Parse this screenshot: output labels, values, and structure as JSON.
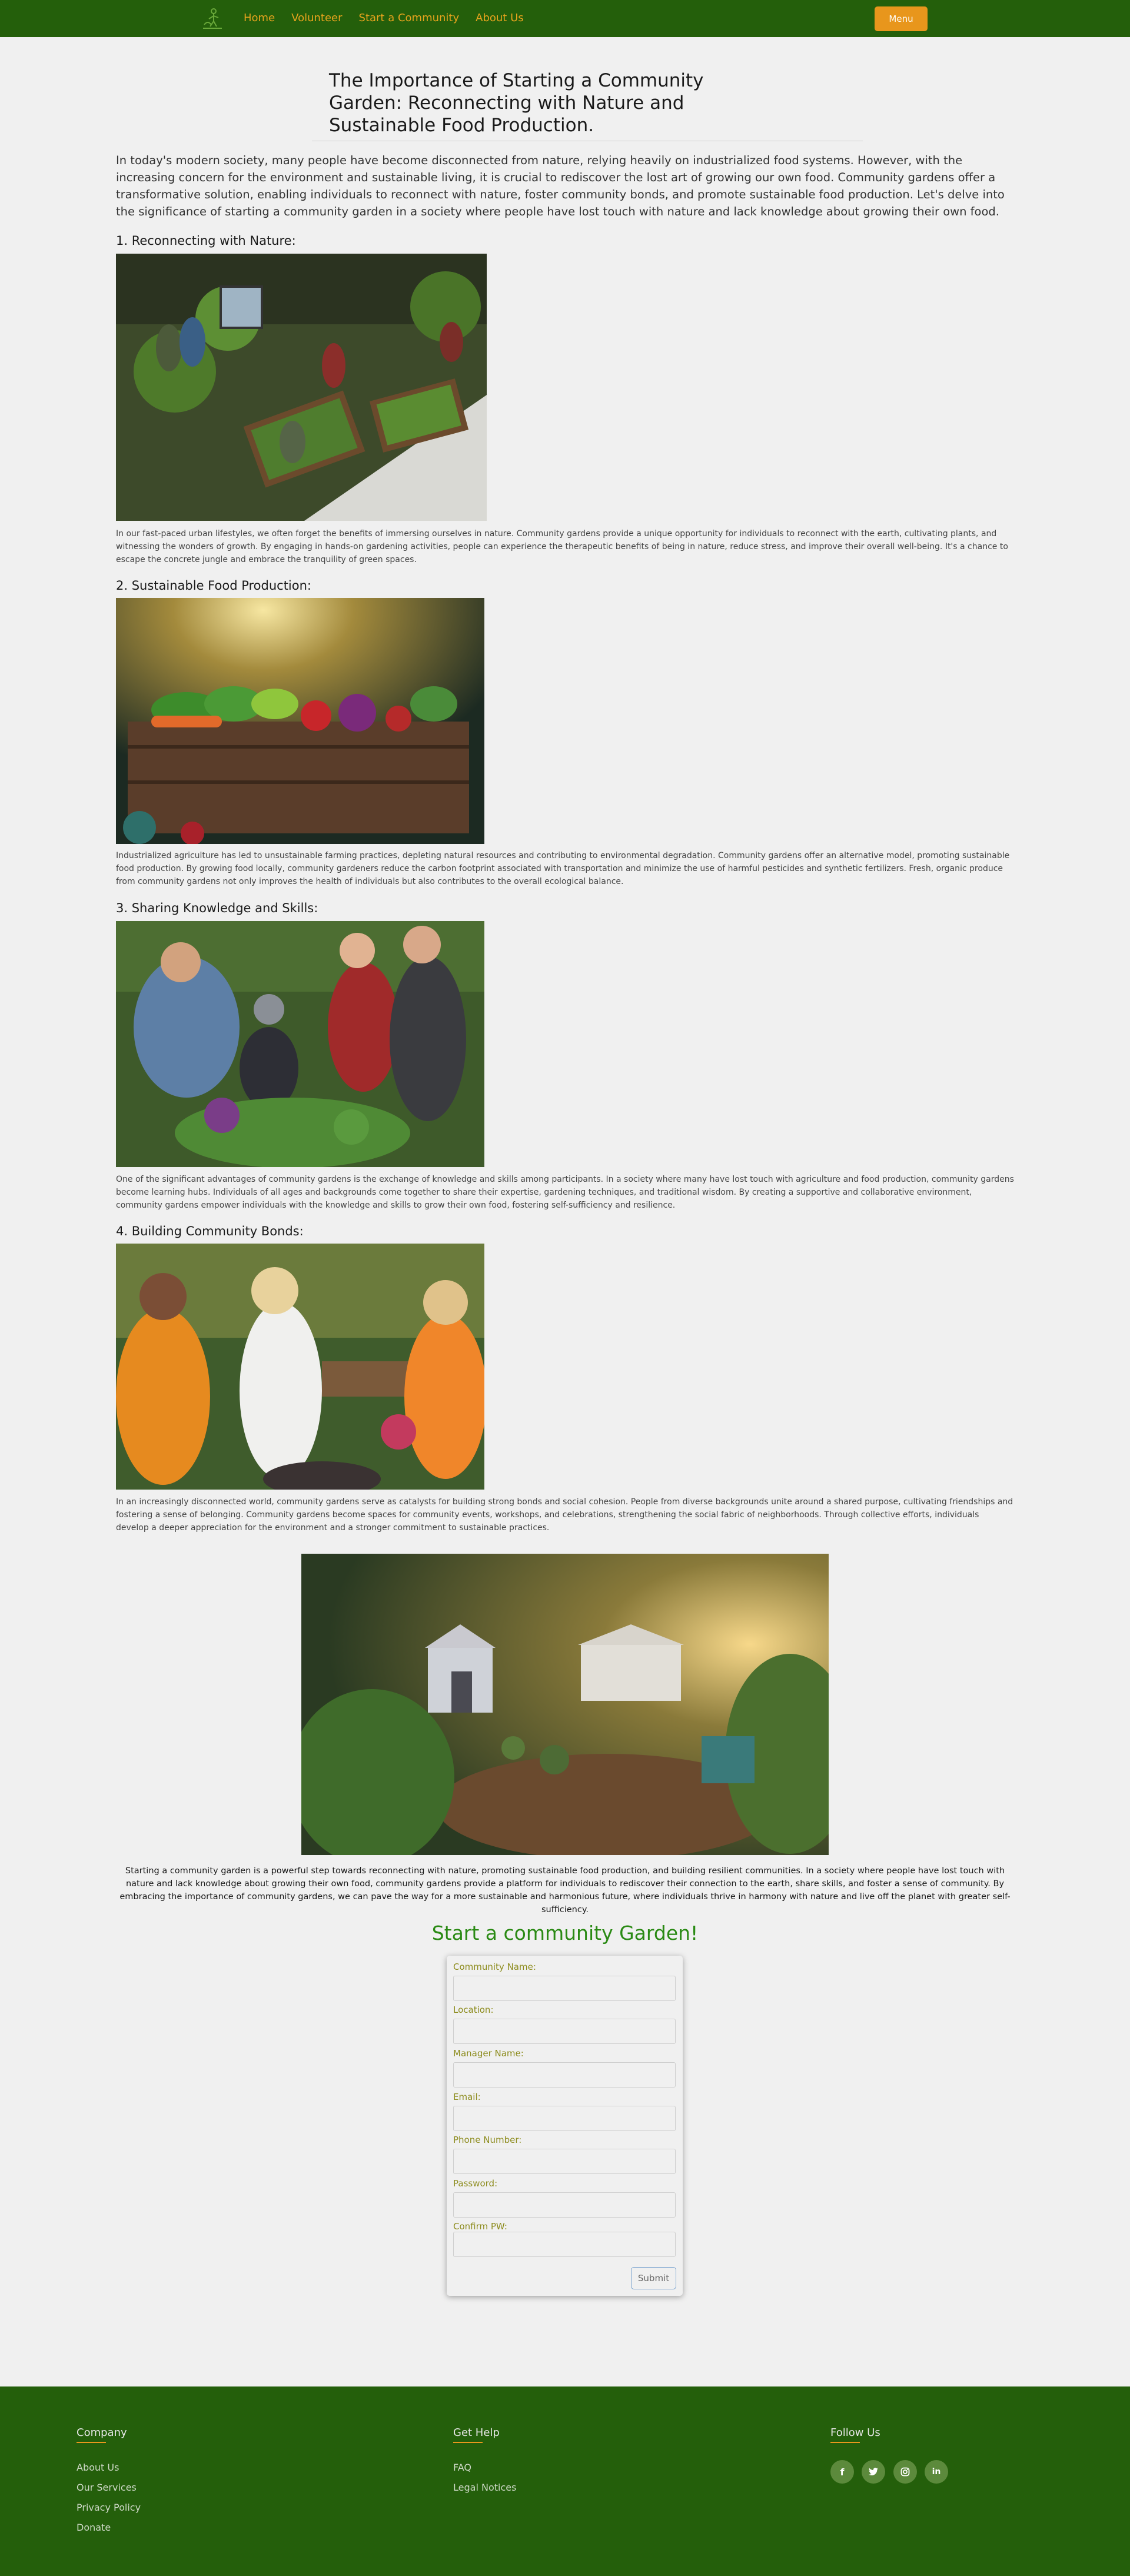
{
  "nav": {
    "links": [
      "Home",
      "Volunteer",
      "Start a Community",
      "About Us"
    ],
    "menu_label": "Menu",
    "logo_icon": "gardener-logo-icon",
    "colors": {
      "bar": "#245f0b",
      "link": "#e8a41d",
      "menu_button": "#e8961c"
    }
  },
  "article": {
    "title": "The Importance of Starting a Community Garden: Reconnecting with Nature and Sustainable Food Production.",
    "intro": "In today's modern society, many people have become disconnected from nature, relying heavily on industrialized food systems. However, with the increasing concern for the environment and sustainable living, it is crucial to rediscover the lost art of growing our own food. Community gardens offer a transformative solution, enabling individuals to reconnect with nature, foster community bonds, and promote sustainable food production. Let's delve into the significance of starting a community garden in a society where people have lost touch with nature and lack knowledge about growing their own food.",
    "sections": [
      {
        "heading": "1. Reconnecting with Nature:",
        "text": "In our fast-paced urban lifestyles, we often forget the benefits of immersing ourselves in nature. Community gardens provide a unique opportunity for individuals to reconnect with the earth, cultivating plants, and witnessing the wonders of growth. By engaging in hands-on gardening activities, people can experience the therapeutic benefits of being in nature, reduce stress, and improve their overall well-being. It's a chance to escape the concrete jungle and embrace the tranquility of green spaces."
      },
      {
        "heading": "2. Sustainable Food Production:",
        "text": "Industrialized agriculture has led to unsustainable farming practices, depleting natural resources and contributing to environmental degradation. Community gardens offer an alternative model, promoting sustainable food production. By growing food locally, community gardeners reduce the carbon footprint associated with transportation and minimize the use of harmful pesticides and synthetic fertilizers. Fresh, organic produce from community gardens not only improves the health of individuals but also contributes to the overall ecological balance."
      },
      {
        "heading": "3. Sharing Knowledge and Skills:",
        "text": "One of the significant advantages of community gardens is the exchange of knowledge and skills among participants. In a society where many have lost touch with agriculture and food production, community gardens become learning hubs. Individuals of all ages and backgrounds come together to share their expertise, gardening techniques, and traditional wisdom. By creating a supportive and collaborative environment, community gardens empower individuals with the knowledge and skills to grow their own food, fostering self-sufficiency and resilience."
      },
      {
        "heading": "4. Building Community Bonds:",
        "text": "In an increasingly disconnected world, community gardens serve as catalysts for building strong bonds and social cohesion. People from diverse backgrounds unite around a shared purpose, cultivating friendships and fostering a sense of belonging. Community gardens become spaces for community events, workshops, and celebrations, strengthening the social fabric of neighborhoods. Through collective efforts, individuals develop a deeper appreciation for the environment and a stronger commitment to sustainable practices."
      }
    ],
    "conclusion": "Starting a community garden is a powerful step towards reconnecting with nature, promoting sustainable food production, and building resilient communities. In a society where people have lost touch with nature and lack knowledge about growing their own food, community gardens provide a platform for individuals to rediscover their connection to the earth, share skills, and foster a sense of community. By embracing the importance of community gardens, we can pave the way for a more sustainable and harmonious future, where individuals thrive in harmony with nature and live off the planet with greater self-sufficiency."
  },
  "form": {
    "title": "Start a community Garden!",
    "fields": [
      {
        "label": "Community Name:"
      },
      {
        "label": "Location:"
      },
      {
        "label": "Manager Name:"
      },
      {
        "label": "Email:"
      },
      {
        "label": "Phone Number:"
      },
      {
        "label": "Password:"
      },
      {
        "label": "Confirm PW:"
      }
    ],
    "submit_label": "Submit"
  },
  "footer": {
    "columns": [
      {
        "heading": "Company",
        "links": [
          "About Us",
          "Our Services",
          "Privacy Policy",
          "Donate"
        ]
      },
      {
        "heading": "Get Help",
        "links": [
          "FAQ",
          "Legal Notices"
        ]
      },
      {
        "heading": "Follow Us",
        "links": []
      }
    ],
    "social_icons": [
      "facebook-icon",
      "twitter-icon",
      "instagram-icon",
      "linkedin-icon"
    ],
    "colors": {
      "background": "#245f0b",
      "accent": "#e8961c"
    }
  }
}
